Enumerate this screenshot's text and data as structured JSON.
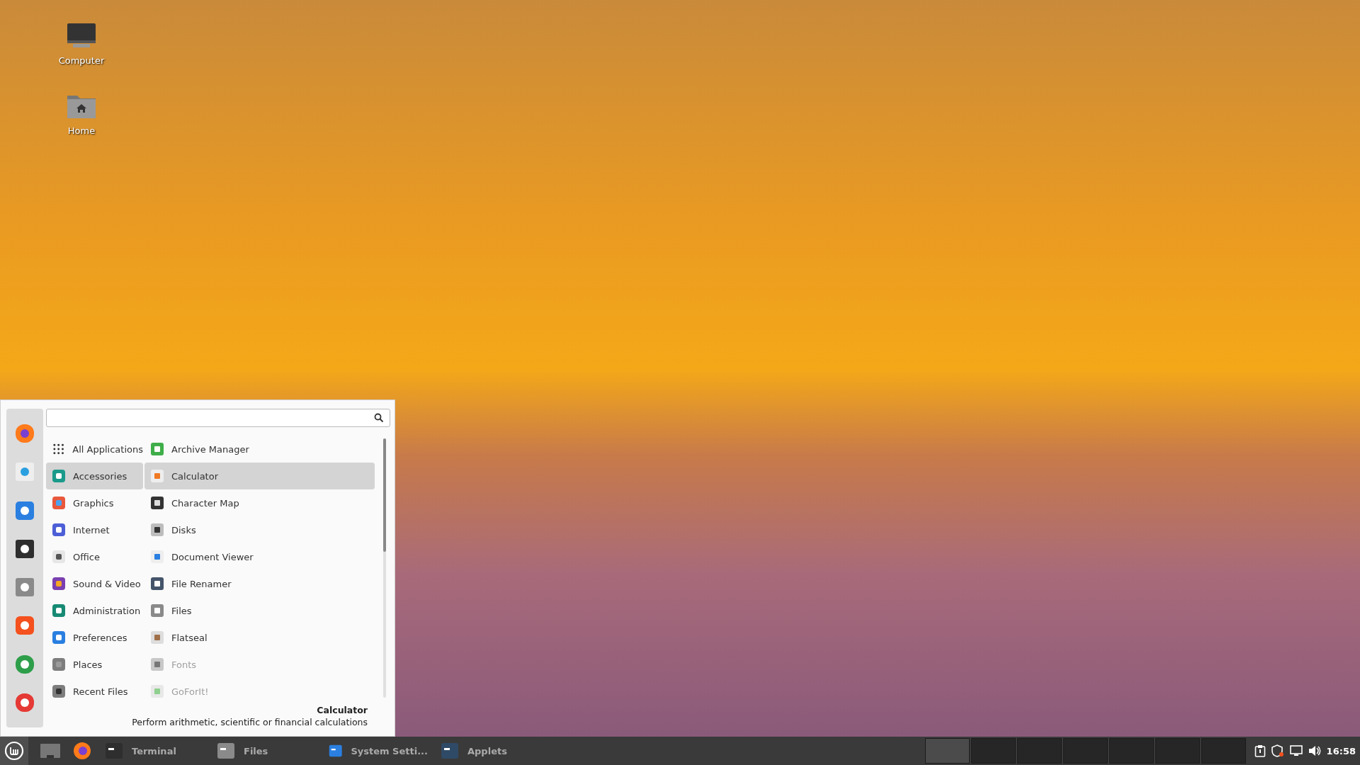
{
  "desktop_icons": [
    {
      "label": "Computer"
    },
    {
      "label": "Home"
    }
  ],
  "menu": {
    "categories": [
      {
        "label": "All Applications",
        "selected": false
      },
      {
        "label": "Accessories",
        "selected": true
      },
      {
        "label": "Graphics",
        "selected": false
      },
      {
        "label": "Internet",
        "selected": false
      },
      {
        "label": "Office",
        "selected": false
      },
      {
        "label": "Sound & Video",
        "selected": false
      },
      {
        "label": "Administration",
        "selected": false
      },
      {
        "label": "Preferences",
        "selected": false
      },
      {
        "label": "Places",
        "selected": false
      },
      {
        "label": "Recent Files",
        "selected": false
      }
    ],
    "apps": [
      {
        "label": "Archive Manager",
        "selected": false,
        "disabled": false
      },
      {
        "label": "Calculator",
        "selected": true,
        "disabled": false
      },
      {
        "label": "Character Map",
        "selected": false,
        "disabled": false
      },
      {
        "label": "Disks",
        "selected": false,
        "disabled": false
      },
      {
        "label": "Document Viewer",
        "selected": false,
        "disabled": false
      },
      {
        "label": "File Renamer",
        "selected": false,
        "disabled": false
      },
      {
        "label": "Files",
        "selected": false,
        "disabled": false
      },
      {
        "label": "Flatseal",
        "selected": false,
        "disabled": false
      },
      {
        "label": "Fonts",
        "selected": false,
        "disabled": true
      },
      {
        "label": "GoForIt!",
        "selected": false,
        "disabled": true
      }
    ],
    "description": {
      "title": "Calculator",
      "text": "Perform arithmetic, scientific or financial calculations"
    }
  },
  "taskbar": {
    "windows": [
      {
        "label": "Terminal"
      },
      {
        "label": "Files"
      },
      {
        "label": "System Setti..."
      },
      {
        "label": "Applets"
      }
    ],
    "workspaces": [
      {
        "selected": true
      },
      {
        "selected": false
      },
      {
        "selected": false
      },
      {
        "selected": false
      },
      {
        "selected": false
      },
      {
        "selected": false
      },
      {
        "selected": false
      }
    ],
    "clock": "16:58"
  }
}
